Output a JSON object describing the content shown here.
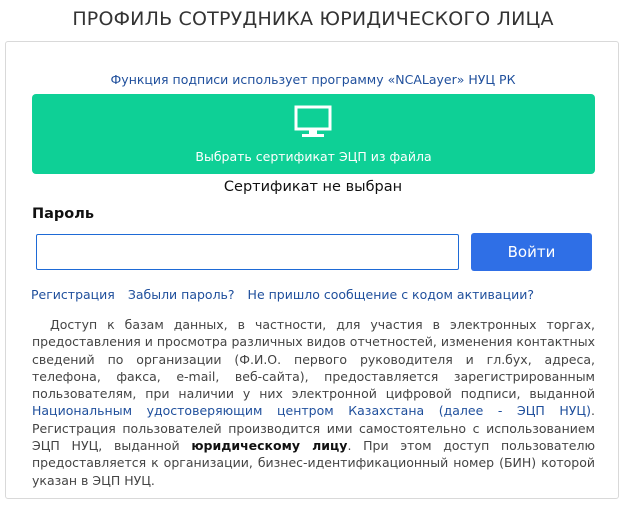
{
  "header": {
    "title": "ПРОФИЛЬ СОТРУДНИКА ЮРИДИЧЕСКОГО ЛИЦА"
  },
  "signing": {
    "note": "Функция подписи использует программу «NCALayer» НУЦ РК",
    "select_button": "Выбрать сертификат ЭЦП из файла",
    "status": "Сертификат не выбран",
    "button_color": "#0ed096"
  },
  "login": {
    "password_label": "Пароль",
    "password_value": "",
    "submit_label": "Войти",
    "submit_color": "#2f6fe6"
  },
  "links": {
    "register": "Регистрация",
    "forgot": "Забыли пароль?",
    "no_activation": "Не пришло сообщение с кодом активации?"
  },
  "info": {
    "part1": "Доступ к базам данных, в частности, для участия в электронных торгах, предоставления и просмотра различных видов отчетностей, изменения контактных сведений по организации (Ф.И.О. первого руководителя и гл.бух, адреса, телефона, факса, e-mail, веб-сайта), предоставляется зарегистрированным пользователям, при наличии у них электронной цифровой подписи, выданной ",
    "link": "Национальным удостоверяющим центром Казахстана (далее - ЭЦП НУЦ)",
    "part2": ". Регистрация пользователей производится ими самостоятельно с использованием ЭЦП НУЦ, выданной ",
    "bold": "юридическому лицу",
    "part3": ". При этом доступ пользователю предоставляется к организации, бизнес-идентификационный номер (БИН) которой указан в ЭЦП НУЦ."
  }
}
